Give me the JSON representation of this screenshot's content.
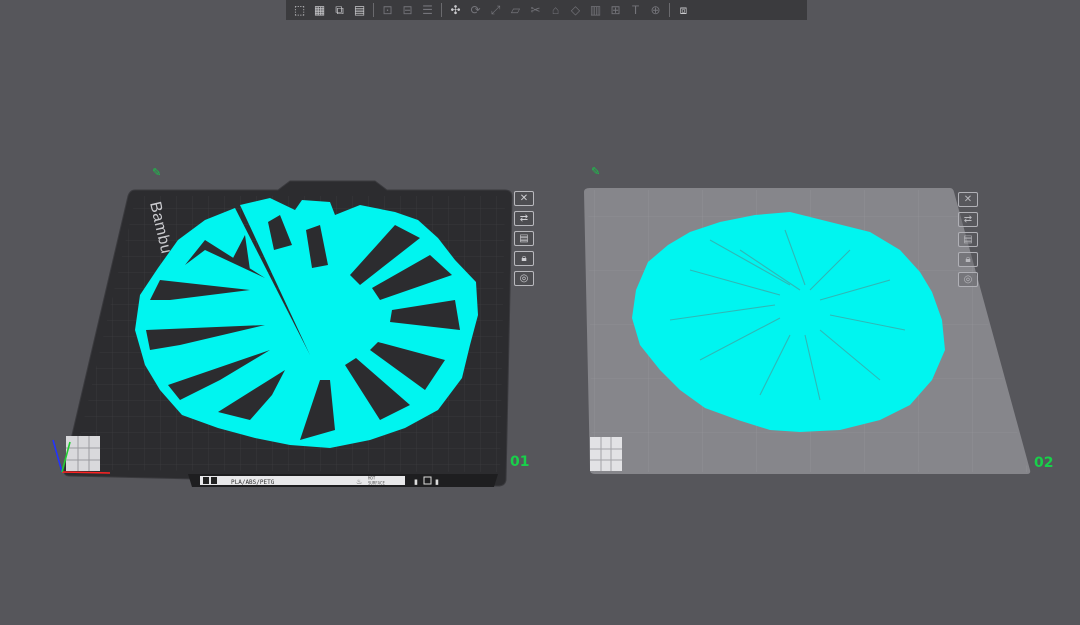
{
  "toolbar": {
    "groups": [
      [
        "add-box-icon",
        "grid-icon",
        "auto-orient-icon",
        "arrange-icon"
      ],
      [
        "split-objects-icon",
        "split-parts-icon",
        "layers-icon"
      ],
      [
        "move-icon",
        "rotate-icon",
        "scale-icon",
        "lay-on-face-icon",
        "cut-icon",
        "support-paint-icon",
        "seam-paint-icon",
        "color-paint-icon",
        "measure-icon",
        "text-icon",
        "boolean-icon"
      ],
      [
        "assembly-view-icon"
      ]
    ]
  },
  "plates": [
    {
      "number": "01",
      "plate_label": "Bambu Textured PEI Plate",
      "filament_label": "PLA/ABS/PETG",
      "hot_label_1": "HOT",
      "hot_label_2": "SURFACE",
      "buttons": [
        "close-icon",
        "auto-arrange-icon",
        "orient-icon",
        "lock-icon",
        "settings-icon"
      ]
    },
    {
      "number": "02",
      "buttons": [
        "close-icon",
        "auto-arrange-icon",
        "orient-icon",
        "lock-icon",
        "settings-icon"
      ]
    }
  ],
  "colors": {
    "background": "#56565b",
    "model": "#00f5f0",
    "plate_dark": "#2e2e31",
    "plate_light": "#8a8a8f",
    "plate_number": "#18d04a",
    "toolbar": "#3b3b3e"
  }
}
